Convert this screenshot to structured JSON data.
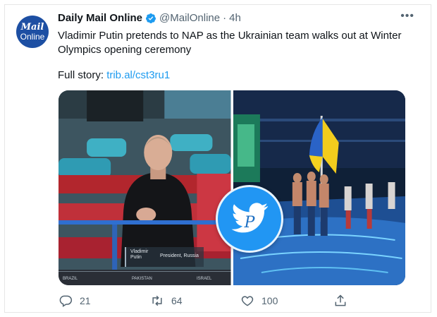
{
  "account": {
    "avatar_line1": "Mail",
    "avatar_line2": "Online",
    "display_name": "Daily Mail Online",
    "handle": "@MailOnline",
    "separator": "·",
    "time": "4h",
    "verified_color": "#1d9bf0"
  },
  "menu": {
    "more_label": "•••"
  },
  "tweet": {
    "text": "Vladimir Putin pretends to NAP as the Ukrainian team walks out at Winter Olympics opening ceremony",
    "full_story_label": "Full story:",
    "link_text": "trib.al/cst3ru1"
  },
  "media": {
    "left_caption_name": "Vladimir Putin",
    "left_caption_title": "President, Russia",
    "left_strip": [
      "BRAZIL",
      "PAKISTAN",
      "ISRAEL"
    ]
  },
  "actions": {
    "replies": "21",
    "retweets": "64",
    "likes": "100"
  },
  "colors": {
    "accent": "#1d9bf0",
    "muted": "#536471",
    "watermark": "#2196f3"
  },
  "icons": [
    "verified-badge-icon",
    "more-icon",
    "reply-icon",
    "retweet-icon",
    "like-icon",
    "share-icon",
    "watermark-bird-icon"
  ]
}
